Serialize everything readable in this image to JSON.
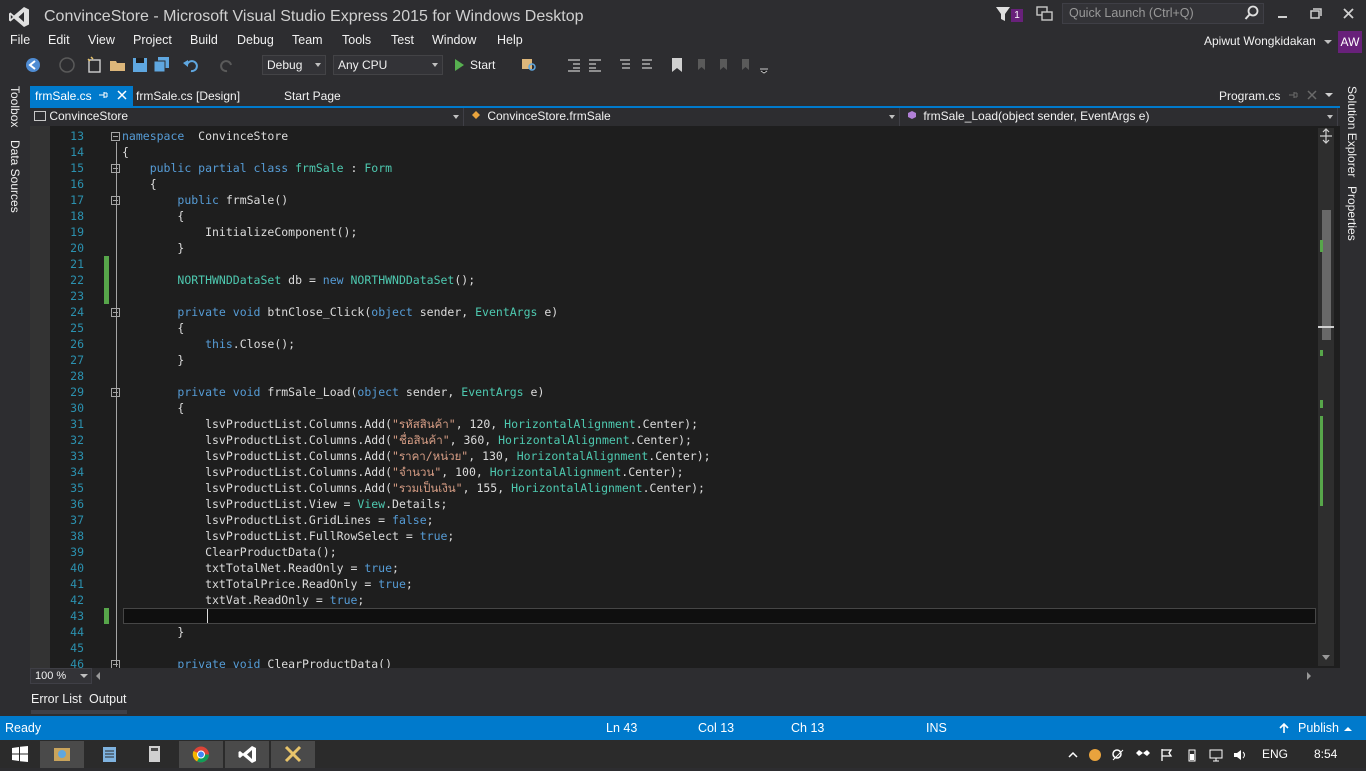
{
  "window": {
    "title": "ConvinceStore - Microsoft Visual Studio Express 2015 for Windows Desktop",
    "notification_count": "1",
    "quick_launch_placeholder": "Quick Launch (Ctrl+Q)",
    "user_name": "Apiwut Wongkidakan",
    "user_initials": "AW"
  },
  "menu": {
    "items": [
      "File",
      "Edit",
      "View",
      "Project",
      "Build",
      "Debug",
      "Team",
      "Tools",
      "Test",
      "Window",
      "Help"
    ]
  },
  "toolbar": {
    "config": "Debug",
    "platform": "Any CPU",
    "start_label": "Start"
  },
  "side_panels": {
    "left": [
      "Toolbox",
      "Data Sources"
    ],
    "right": [
      "Solution Explorer",
      "Properties"
    ]
  },
  "tabs": {
    "active": "frmSale.cs",
    "others": [
      "frmSale.cs [Design]",
      "Start Page"
    ],
    "right": "Program.cs"
  },
  "navbar": {
    "project": "ConvinceStore",
    "class": "ConvinceStore.frmSale",
    "member": "frmSale_Load(object sender, EventArgs e)"
  },
  "code": {
    "lines": [
      {
        "n": "13",
        "segs": [
          [
            "kw",
            "namespace"
          ],
          [
            "",
            "  ConvinceStore"
          ]
        ]
      },
      {
        "n": "14",
        "segs": [
          [
            "",
            "{"
          ]
        ]
      },
      {
        "n": "15",
        "segs": [
          [
            "",
            "    "
          ],
          [
            "kw",
            "public partial class "
          ],
          [
            "ty",
            "frmSale"
          ],
          [
            "",
            " : "
          ],
          [
            "ty",
            "Form"
          ]
        ]
      },
      {
        "n": "16",
        "segs": [
          [
            "",
            "    {"
          ]
        ]
      },
      {
        "n": "17",
        "segs": [
          [
            "",
            "        "
          ],
          [
            "kw",
            "public "
          ],
          [
            "",
            "frmSale()"
          ]
        ]
      },
      {
        "n": "18",
        "segs": [
          [
            "",
            "        {"
          ]
        ]
      },
      {
        "n": "19",
        "segs": [
          [
            "",
            "            InitializeComponent();"
          ]
        ]
      },
      {
        "n": "20",
        "segs": [
          [
            "",
            "        }"
          ]
        ]
      },
      {
        "n": "21",
        "segs": [
          [
            "",
            ""
          ]
        ]
      },
      {
        "n": "22",
        "segs": [
          [
            "",
            "        "
          ],
          [
            "ty",
            "NORTHWNDDataSet"
          ],
          [
            "",
            " db = "
          ],
          [
            "kw",
            "new "
          ],
          [
            "ty",
            "NORTHWNDDataSet"
          ],
          [
            "",
            "();"
          ]
        ]
      },
      {
        "n": "23",
        "segs": [
          [
            "",
            ""
          ]
        ]
      },
      {
        "n": "24",
        "segs": [
          [
            "",
            "        "
          ],
          [
            "kw",
            "private void "
          ],
          [
            "",
            "btnClose_Click("
          ],
          [
            "kw",
            "object "
          ],
          [
            "",
            "sender, "
          ],
          [
            "ty",
            "EventArgs"
          ],
          [
            "",
            " e)"
          ]
        ]
      },
      {
        "n": "25",
        "segs": [
          [
            "",
            "        {"
          ]
        ]
      },
      {
        "n": "26",
        "segs": [
          [
            "",
            "            "
          ],
          [
            "kw",
            "this"
          ],
          [
            "",
            ".Close();"
          ]
        ]
      },
      {
        "n": "27",
        "segs": [
          [
            "",
            "        }"
          ]
        ]
      },
      {
        "n": "28",
        "segs": [
          [
            "",
            ""
          ]
        ]
      },
      {
        "n": "29",
        "segs": [
          [
            "",
            "        "
          ],
          [
            "kw",
            "private void "
          ],
          [
            "",
            "frmSale_Load("
          ],
          [
            "kw",
            "object "
          ],
          [
            "",
            "sender, "
          ],
          [
            "ty",
            "EventArgs"
          ],
          [
            "",
            " e)"
          ]
        ]
      },
      {
        "n": "30",
        "segs": [
          [
            "",
            "        {"
          ]
        ]
      },
      {
        "n": "31",
        "segs": [
          [
            "",
            "            lsvProductList.Columns.Add("
          ],
          [
            "st",
            "\"รหัสสินค้า\""
          ],
          [
            "",
            ", 120, "
          ],
          [
            "ty",
            "HorizontalAlignment"
          ],
          [
            "",
            ".Center);"
          ]
        ]
      },
      {
        "n": "32",
        "segs": [
          [
            "",
            "            lsvProductList.Columns.Add("
          ],
          [
            "st",
            "\"ชื่อสินค้า\""
          ],
          [
            "",
            ", 360, "
          ],
          [
            "ty",
            "HorizontalAlignment"
          ],
          [
            "",
            ".Center);"
          ]
        ]
      },
      {
        "n": "33",
        "segs": [
          [
            "",
            "            lsvProductList.Columns.Add("
          ],
          [
            "st",
            "\"ราคา/หน่วย\""
          ],
          [
            "",
            ", 130, "
          ],
          [
            "ty",
            "HorizontalAlignment"
          ],
          [
            "",
            ".Center);"
          ]
        ]
      },
      {
        "n": "34",
        "segs": [
          [
            "",
            "            lsvProductList.Columns.Add("
          ],
          [
            "st",
            "\"จำนวน\""
          ],
          [
            "",
            ", 100, "
          ],
          [
            "ty",
            "HorizontalAlignment"
          ],
          [
            "",
            ".Center);"
          ]
        ]
      },
      {
        "n": "35",
        "segs": [
          [
            "",
            "            lsvProductList.Columns.Add("
          ],
          [
            "st",
            "\"รวมเป็นเงิน\""
          ],
          [
            "",
            ", 155, "
          ],
          [
            "ty",
            "HorizontalAlignment"
          ],
          [
            "",
            ".Center);"
          ]
        ]
      },
      {
        "n": "36",
        "segs": [
          [
            "",
            "            lsvProductList.View = "
          ],
          [
            "ty",
            "View"
          ],
          [
            "",
            ".Details;"
          ]
        ]
      },
      {
        "n": "37",
        "segs": [
          [
            "",
            "            lsvProductList.GridLines = "
          ],
          [
            "kw",
            "false"
          ],
          [
            "",
            ";"
          ]
        ]
      },
      {
        "n": "38",
        "segs": [
          [
            "",
            "            lsvProductList.FullRowSelect = "
          ],
          [
            "kw",
            "true"
          ],
          [
            "",
            ";"
          ]
        ]
      },
      {
        "n": "39",
        "segs": [
          [
            "",
            "            ClearProductData();"
          ]
        ]
      },
      {
        "n": "40",
        "segs": [
          [
            "",
            "            txtTotalNet.ReadOnly = "
          ],
          [
            "kw",
            "true"
          ],
          [
            "",
            ";"
          ]
        ]
      },
      {
        "n": "41",
        "segs": [
          [
            "",
            "            txtTotalPrice.ReadOnly = "
          ],
          [
            "kw",
            "true"
          ],
          [
            "",
            ";"
          ]
        ]
      },
      {
        "n": "42",
        "segs": [
          [
            "",
            "            txtVat.ReadOnly = "
          ],
          [
            "kw",
            "true"
          ],
          [
            "",
            ";"
          ]
        ]
      },
      {
        "n": "43",
        "segs": [
          [
            "",
            ""
          ]
        ]
      },
      {
        "n": "44",
        "segs": [
          [
            "",
            "        }"
          ]
        ]
      },
      {
        "n": "45",
        "segs": [
          [
            "",
            ""
          ]
        ]
      },
      {
        "n": "46",
        "segs": [
          [
            "",
            "        "
          ],
          [
            "kw",
            "private void "
          ],
          [
            "",
            "ClearProductData()"
          ]
        ]
      }
    ],
    "folded_lines": [
      "13",
      "15",
      "17",
      "24",
      "29",
      "46"
    ],
    "changed_lines": [
      "21",
      "22",
      "23",
      "43"
    ]
  },
  "editor": {
    "zoom": "100 %"
  },
  "bottom_tabs": [
    "Error List",
    "Output"
  ],
  "status": {
    "state": "Ready",
    "ln": "Ln 43",
    "col": "Col 13",
    "ch": "Ch 13",
    "mode": "INS",
    "publish": "Publish"
  },
  "taskbar": {
    "language": "ENG",
    "time": "8:54"
  },
  "colors": {
    "accent": "#007acc",
    "keyword": "#569cd6",
    "type": "#4ec9b0",
    "string": "#d69d85",
    "line_number": "#2b91af",
    "change_marker": "#57a64a"
  }
}
